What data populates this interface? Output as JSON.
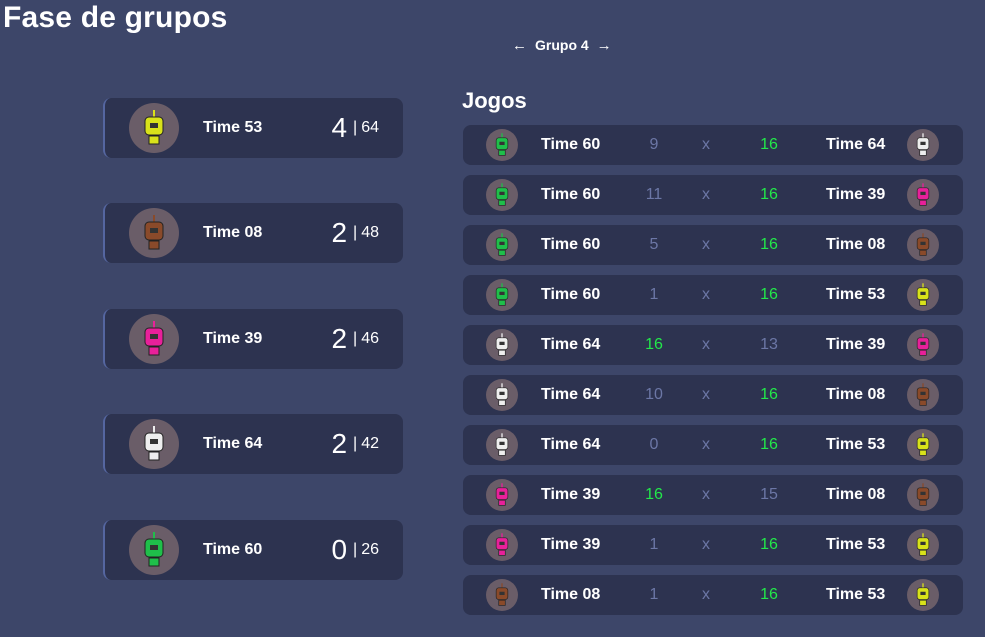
{
  "page": {
    "title": "Fase de grupos"
  },
  "group_nav": {
    "label": "Grupo 4",
    "prev_icon": "←",
    "next_icon": "→"
  },
  "colors": {
    "background": "#3d4669",
    "card": "#2d3350",
    "win": "#22e84a",
    "muted": "#6c77a6"
  },
  "standings": [
    {
      "name": "Time 53",
      "points": "4",
      "sep": "|",
      "score": "64",
      "color": "#d9e21a"
    },
    {
      "name": "Time 08",
      "points": "2",
      "sep": "|",
      "score": "48",
      "color": "#8a4a2a"
    },
    {
      "name": "Time 39",
      "points": "2",
      "sep": "|",
      "score": "46",
      "color": "#e8209a"
    },
    {
      "name": "Time 64",
      "points": "2",
      "sep": "|",
      "score": "42",
      "color": "#eeeeee"
    },
    {
      "name": "Time 60",
      "points": "0",
      "sep": "|",
      "score": "26",
      "color": "#1fbf4a"
    }
  ],
  "matches": {
    "title": "Jogos",
    "rows": [
      {
        "home": "Time 60",
        "home_score": "9",
        "vs": "x",
        "away_score": "16",
        "away": "Time 64",
        "home_color": "#1fbf4a",
        "away_color": "#eeeeee",
        "winner": "away"
      },
      {
        "home": "Time 60",
        "home_score": "11",
        "vs": "x",
        "away_score": "16",
        "away": "Time 39",
        "home_color": "#1fbf4a",
        "away_color": "#e8209a",
        "winner": "away"
      },
      {
        "home": "Time 60",
        "home_score": "5",
        "vs": "x",
        "away_score": "16",
        "away": "Time 08",
        "home_color": "#1fbf4a",
        "away_color": "#8a4a2a",
        "winner": "away"
      },
      {
        "home": "Time 60",
        "home_score": "1",
        "vs": "x",
        "away_score": "16",
        "away": "Time 53",
        "home_color": "#1fbf4a",
        "away_color": "#d9e21a",
        "winner": "away"
      },
      {
        "home": "Time 64",
        "home_score": "16",
        "vs": "x",
        "away_score": "13",
        "away": "Time 39",
        "home_color": "#eeeeee",
        "away_color": "#e8209a",
        "winner": "home"
      },
      {
        "home": "Time 64",
        "home_score": "10",
        "vs": "x",
        "away_score": "16",
        "away": "Time 08",
        "home_color": "#eeeeee",
        "away_color": "#8a4a2a",
        "winner": "away"
      },
      {
        "home": "Time 64",
        "home_score": "0",
        "vs": "x",
        "away_score": "16",
        "away": "Time 53",
        "home_color": "#eeeeee",
        "away_color": "#d9e21a",
        "winner": "away"
      },
      {
        "home": "Time 39",
        "home_score": "16",
        "vs": "x",
        "away_score": "15",
        "away": "Time 08",
        "home_color": "#e8209a",
        "away_color": "#8a4a2a",
        "winner": "home"
      },
      {
        "home": "Time 39",
        "home_score": "1",
        "vs": "x",
        "away_score": "16",
        "away": "Time 53",
        "home_color": "#e8209a",
        "away_color": "#d9e21a",
        "winner": "away"
      },
      {
        "home": "Time 08",
        "home_score": "1",
        "vs": "x",
        "away_score": "16",
        "away": "Time 53",
        "home_color": "#8a4a2a",
        "away_color": "#d9e21a",
        "winner": "away"
      }
    ]
  }
}
